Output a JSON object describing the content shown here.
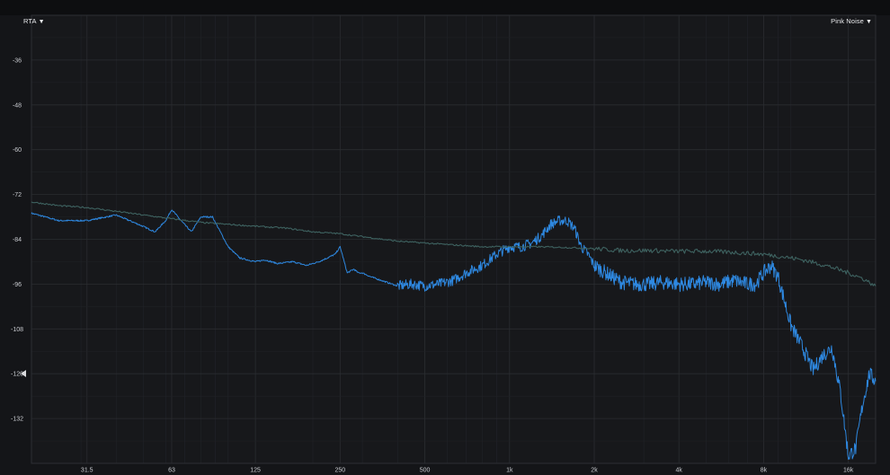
{
  "header": {
    "left_menu": {
      "label": "RTA",
      "icon": "triangle-down-icon"
    },
    "right_menu": {
      "label": "Pink Noise",
      "icon": "triangle-down-icon"
    }
  },
  "colors": {
    "background": "#141518",
    "plot_background": "#17181b",
    "grid": "#2a2c30",
    "series_measured": "#2e88e0",
    "series_reference": "#3e6260"
  },
  "chart_data": {
    "type": "line",
    "title": "",
    "xlabel": "",
    "ylabel": "",
    "x_scale": "log",
    "xlim": [
      20,
      20000
    ],
    "ylim": [
      -144,
      -24
    ],
    "grid": true,
    "x_tick_labels": [
      {
        "value": 31.5,
        "label": "31.5"
      },
      {
        "value": 63,
        "label": "63"
      },
      {
        "value": 125,
        "label": "125"
      },
      {
        "value": 250,
        "label": "250"
      },
      {
        "value": 500,
        "label": "500"
      },
      {
        "value": 1000,
        "label": "1k"
      },
      {
        "value": 2000,
        "label": "2k"
      },
      {
        "value": 4000,
        "label": "4k"
      },
      {
        "value": 8000,
        "label": "8k"
      },
      {
        "value": 16000,
        "label": "16k"
      }
    ],
    "y_ticks": [
      -36,
      -48,
      -60,
      -72,
      -84,
      -96,
      -108,
      -120,
      -132
    ],
    "reference_level": -120,
    "series": [
      {
        "key": "measured",
        "x": [
          20,
          25,
          31.5,
          40,
          48,
          55,
          60,
          63,
          68,
          74,
          80,
          88,
          100,
          110,
          125,
          135,
          150,
          170,
          190,
          210,
          225,
          240,
          250,
          265,
          280,
          290,
          300,
          320,
          350,
          400,
          450,
          500,
          560,
          630,
          700,
          800,
          900,
          1000,
          1100,
          1200,
          1300,
          1400,
          1500,
          1600,
          1700,
          1800,
          1900,
          2000,
          2200,
          2500,
          2800,
          3150,
          3500,
          4000,
          4500,
          5000,
          5600,
          6300,
          7000,
          7500,
          8000,
          8500,
          9000,
          10000,
          11000,
          12000,
          13000,
          14000,
          15000,
          16000,
          17000,
          18000,
          19000,
          20000
        ],
        "y": [
          -77,
          -79,
          -79,
          -77.5,
          -80,
          -82,
          -79,
          -76,
          -79,
          -82,
          -78,
          -78,
          -86,
          -89,
          -90,
          -89.5,
          -90.5,
          -90,
          -91,
          -90,
          -89,
          -88,
          -86,
          -93,
          -92,
          -93,
          -93,
          -94,
          -95,
          -96.5,
          -96,
          -96.5,
          -96,
          -95,
          -93,
          -91,
          -88,
          -86,
          -86,
          -85,
          -83,
          -80,
          -79,
          -79,
          -81,
          -86,
          -88,
          -91,
          -93,
          -95.5,
          -96,
          -96,
          -95.5,
          -96,
          -96,
          -95.5,
          -96,
          -95,
          -96,
          -96,
          -93,
          -91,
          -94,
          -107,
          -113,
          -119,
          -115,
          -113,
          -125,
          -142,
          -140,
          -128,
          -120,
          -122
        ]
      },
      {
        "key": "reference",
        "x": [
          20,
          25,
          31.5,
          40,
          50,
          63,
          80,
          100,
          125,
          160,
          200,
          250,
          315,
          400,
          500,
          630,
          800,
          1000,
          1250,
          1600,
          2000,
          2500,
          3150,
          4000,
          5000,
          6300,
          8000,
          9000,
          10000,
          11000,
          12500,
          14000,
          16000,
          18000,
          20000
        ],
        "y": [
          -74,
          -75,
          -75.5,
          -76.5,
          -77.5,
          -78.5,
          -79.5,
          -80,
          -80.5,
          -81,
          -82,
          -82.5,
          -83.5,
          -84.5,
          -85,
          -85.5,
          -86,
          -86,
          -86,
          -86.2,
          -86.5,
          -87,
          -87,
          -87.2,
          -87.2,
          -87.5,
          -88,
          -88.5,
          -89,
          -89.5,
          -90.5,
          -91.5,
          -93,
          -94.5,
          -96.5
        ]
      }
    ]
  }
}
